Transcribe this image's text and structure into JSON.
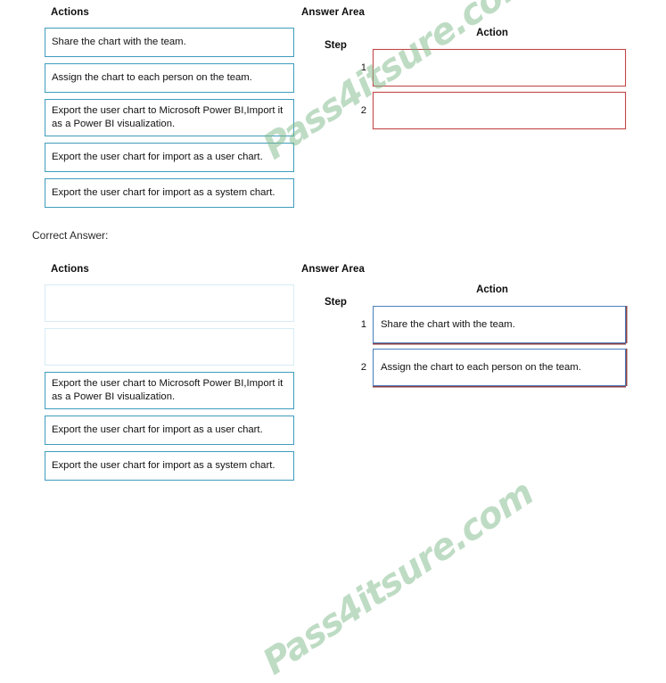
{
  "watermark": {
    "text": "Pass4itsure.com",
    "color": "#7eba89"
  },
  "colors": {
    "action_border": "#3f9cbd",
    "empty_border": "#d6ecf4",
    "blank_slot_border": "#c2474a",
    "filled_slot_border": "#4a7fbd",
    "filled_slot_backing": "#8b3d3f"
  },
  "correct_answer_label": "Correct Answer:",
  "question_panel": {
    "actions": {
      "header": "Actions",
      "items": [
        {
          "text": "Share the chart with the team.",
          "empty": false,
          "tall": false
        },
        {
          "text": "Assign the chart to each person on the team.",
          "empty": false,
          "tall": false
        },
        {
          "text": "Export the user chart to Microsoft Power BI,Import it as a Power BI visualization.",
          "empty": false,
          "tall": true
        },
        {
          "text": "Export the user chart for import as a user chart.",
          "empty": false,
          "tall": false
        },
        {
          "text": "Export the user chart for import as a system chart.",
          "empty": false,
          "tall": false
        }
      ]
    },
    "answer_area": {
      "header": "Answer Area",
      "col_step": "Step",
      "col_action": "Action",
      "rows": [
        {
          "step": "1",
          "action": ""
        },
        {
          "step": "2",
          "action": ""
        }
      ]
    }
  },
  "answer_panel": {
    "actions": {
      "header": "Actions",
      "items": [
        {
          "text": "",
          "empty": true,
          "tall": false
        },
        {
          "text": "",
          "empty": true,
          "tall": false
        },
        {
          "text": "Export the user chart to Microsoft Power BI,Import it as a Power BI visualization.",
          "empty": false,
          "tall": true
        },
        {
          "text": "Export the user chart for import as a user chart.",
          "empty": false,
          "tall": false
        },
        {
          "text": "Export the user chart for import as a system chart.",
          "empty": false,
          "tall": false
        }
      ]
    },
    "answer_area": {
      "header": "Answer Area",
      "col_step": "Step",
      "col_action": "Action",
      "rows": [
        {
          "step": "1",
          "action": "Share the chart with the team."
        },
        {
          "step": "2",
          "action": "Assign the chart to each person on the team."
        }
      ]
    }
  }
}
